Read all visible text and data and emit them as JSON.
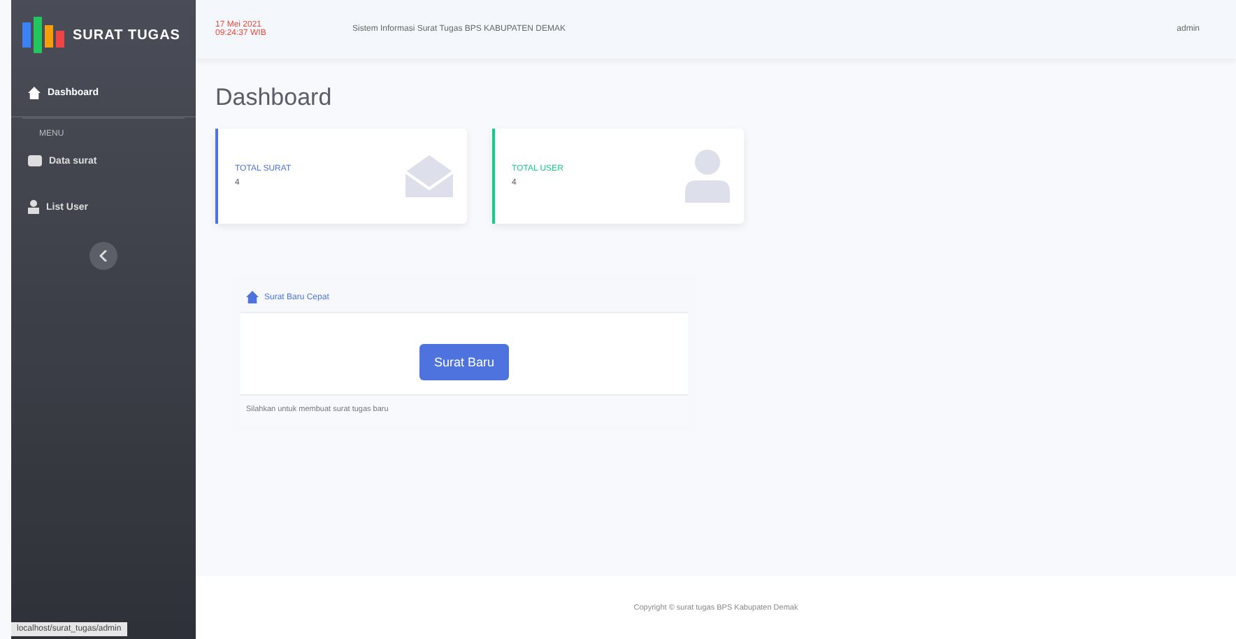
{
  "brand": "SURAT TUGAS",
  "topbar": {
    "date": "17 Mei 2021",
    "time": "09:24:37 WIB",
    "title": "Sistem Informasi Surat Tugas BPS KABUPATEN DEMAK",
    "user": "admin"
  },
  "sidebar": {
    "items": [
      {
        "label": "Dashboard",
        "kind": "home",
        "selected": true
      },
      {
        "kind": "heading",
        "label": "MENU"
      },
      {
        "label": "Data surat",
        "kind": "mail",
        "selected": false
      },
      {
        "label": "List User",
        "kind": "user",
        "selected": false
      }
    ]
  },
  "page_title": "Dashboard",
  "cards": [
    {
      "label": "TOTAL SURAT",
      "value": "4",
      "color": "#4e73df",
      "kind": "mail"
    },
    {
      "label": "TOTAL USER",
      "value": "4",
      "color": "#1cc88a",
      "kind": "user"
    }
  ],
  "panel": {
    "header": "Surat Baru Cepat",
    "button": "Surat Baru",
    "note": "Silahkan untuk membuat surat tugas baru"
  },
  "footer": "Copyright © surat tugas BPS Kabupaten Demak",
  "status_url": "localhost/surat_tugas/admin"
}
